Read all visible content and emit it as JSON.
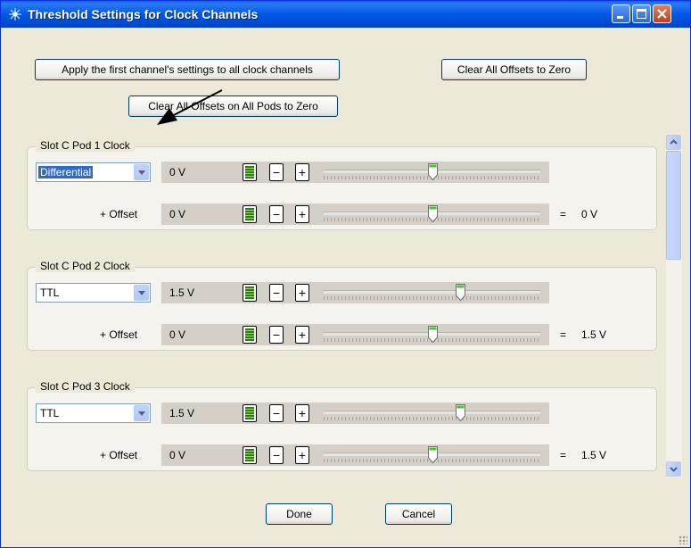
{
  "window": {
    "title": "Threshold Settings for Clock Channels"
  },
  "buttons": {
    "apply_all": "Apply the first channel's settings to all clock channels",
    "clear_offsets": "Clear All Offsets to Zero",
    "clear_pods": "Clear All Offsets on All Pods to Zero",
    "done": "Done",
    "cancel": "Cancel"
  },
  "common": {
    "offset_label": "+ Offset",
    "minus": "−",
    "plus": "+",
    "equals": "="
  },
  "groups": [
    {
      "label": "Slot C Pod 1   Clock",
      "mode": "Differential",
      "threshold_value": "0 V",
      "threshold_level": 0.5,
      "offset_value": "0 V",
      "offset_level": 0.5,
      "total": "0 V"
    },
    {
      "label": "Slot C Pod 2   Clock",
      "mode": "TTL",
      "threshold_value": "1.5 V",
      "threshold_level": 0.63,
      "offset_value": "0 V",
      "offset_level": 0.5,
      "total": "1.5 V"
    },
    {
      "label": "Slot C Pod 3   Clock",
      "mode": "TTL",
      "threshold_value": "1.5 V",
      "threshold_level": 0.63,
      "offset_value": "0 V",
      "offset_level": 0.5,
      "total": "1.5 V"
    }
  ]
}
